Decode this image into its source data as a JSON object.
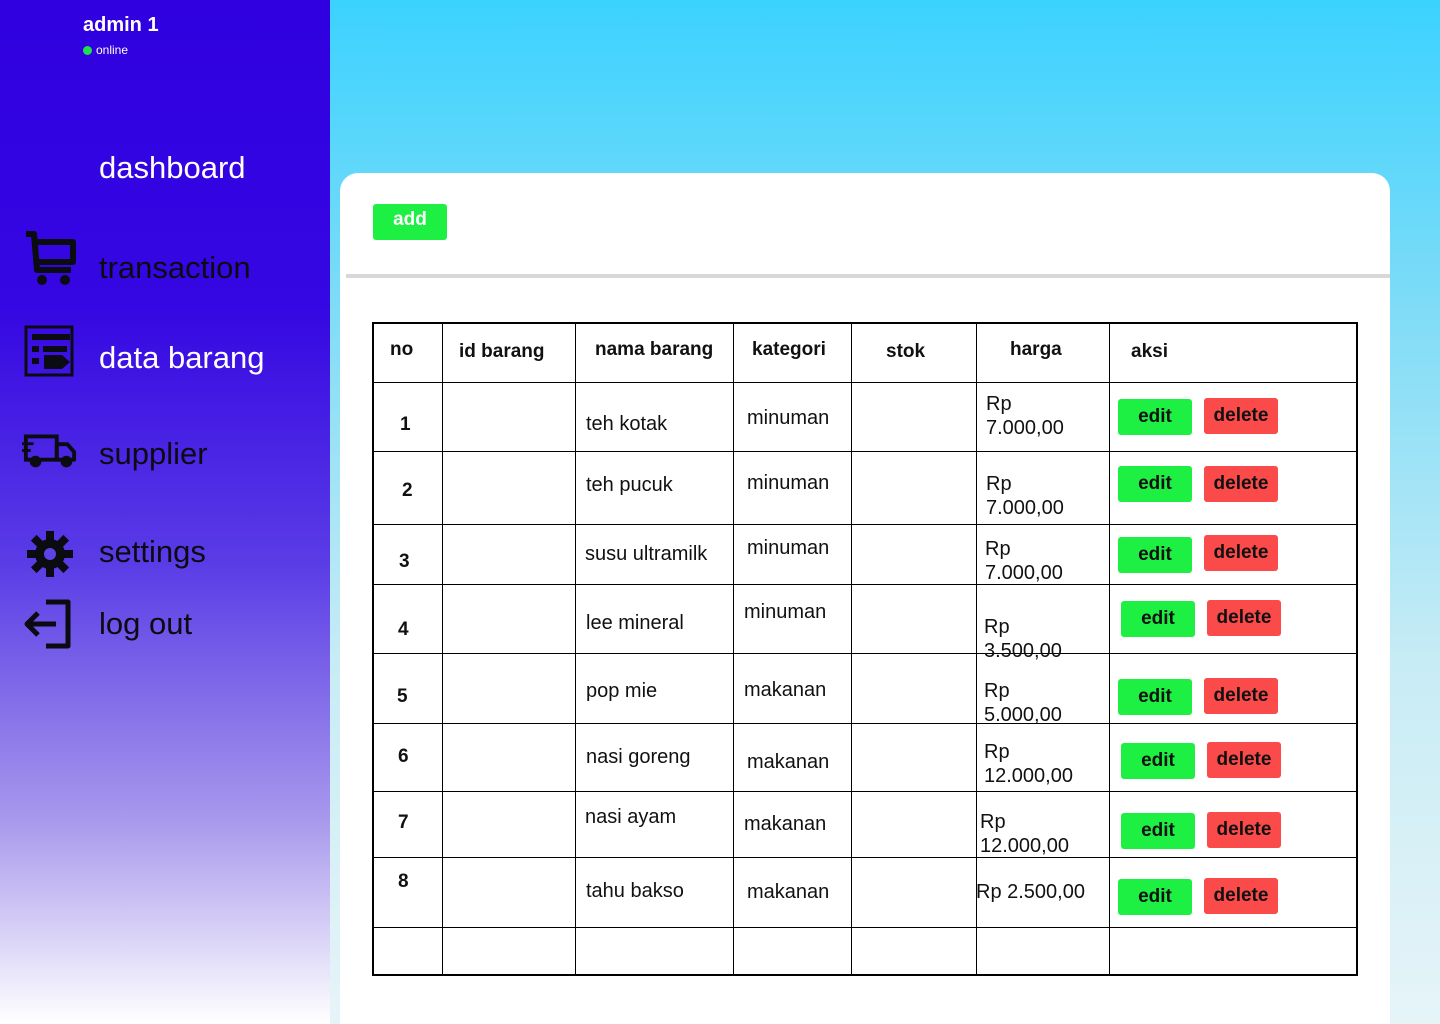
{
  "sidebar": {
    "admin_name": "admin 1",
    "status": "online",
    "items": [
      {
        "label": "dashboard",
        "icon": "none"
      },
      {
        "label": "transaction",
        "icon": "cart-icon"
      },
      {
        "label": "data barang",
        "icon": "list-tag-icon"
      },
      {
        "label": "supplier",
        "icon": "truck-icon"
      },
      {
        "label": "settings",
        "icon": "gear-icon"
      },
      {
        "label": "log out",
        "icon": "logout-icon"
      }
    ]
  },
  "toolbar": {
    "add_label": "add"
  },
  "table": {
    "headers": [
      "no",
      "id barang",
      "nama barang",
      "kategori",
      "stok",
      "harga",
      "aksi"
    ],
    "rows": [
      {
        "no": "1",
        "id": "",
        "nama": "teh kotak",
        "kategori": "minuman",
        "stok": "",
        "harga_a": "Rp",
        "harga_b": "7.000,00"
      },
      {
        "no": "2",
        "id": "",
        "nama": "teh pucuk",
        "kategori": "minuman",
        "stok": "",
        "harga_a": "Rp",
        "harga_b": "7.000,00"
      },
      {
        "no": "3",
        "id": "",
        "nama": "susu ultramilk",
        "kategori": "minuman",
        "stok": "",
        "harga_a": "Rp",
        "harga_b": "7.000,00"
      },
      {
        "no": "4",
        "id": "",
        "nama": "lee mineral",
        "kategori": "minuman",
        "stok": "",
        "harga_a": "Rp",
        "harga_b": "3.500,00"
      },
      {
        "no": "5",
        "id": "",
        "nama": "pop mie",
        "kategori": "makanan",
        "stok": "",
        "harga_a": "Rp",
        "harga_b": "5.000,00"
      },
      {
        "no": "6",
        "id": "",
        "nama": "nasi goreng",
        "kategori": "makanan",
        "stok": "",
        "harga_a": "Rp",
        "harga_b": "12.000,00"
      },
      {
        "no": "7",
        "id": "",
        "nama": "nasi ayam",
        "kategori": "makanan",
        "stok": "",
        "harga_a": "Rp",
        "harga_b": "12.000,00"
      },
      {
        "no": "8",
        "id": "",
        "nama": "tahu bakso",
        "kategori": "makanan",
        "stok": "",
        "harga_a": "Rp 2.500,00",
        "harga_b": ""
      }
    ],
    "edit_label": "edit",
    "delete_label": "delete"
  },
  "colors": {
    "sidebar_top": "#3000e0",
    "accent_green": "#1ef043",
    "accent_red": "#fa4a4a",
    "status_dot": "#22e04a",
    "background_top": "#3bd2ff"
  }
}
